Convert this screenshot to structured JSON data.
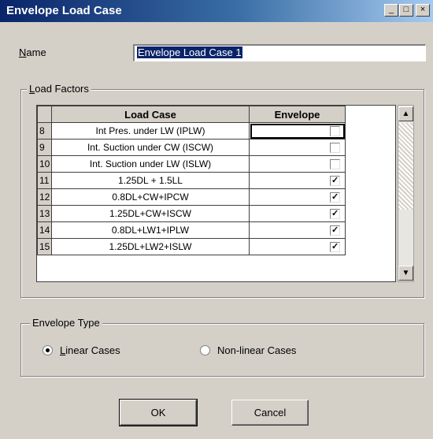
{
  "window": {
    "title": "Envelope Load Case",
    "min_glyph": "_",
    "max_glyph": "□",
    "close_glyph": "×"
  },
  "name_field": {
    "label_u": "N",
    "label_rest": "ame",
    "value": "Envelope Load Case 1"
  },
  "load_factors": {
    "title_u": "L",
    "title_rest": "oad Factors",
    "columns": [
      "Load Case",
      "Envelope"
    ],
    "rows": [
      {
        "id": "8",
        "case": "Int Pres. under LW (IPLW)",
        "envelope": false
      },
      {
        "id": "9",
        "case": "Int. Suction under CW (ISCW)",
        "envelope": false
      },
      {
        "id": "10",
        "case": "Int. Suction under LW (ISLW)",
        "envelope": false
      },
      {
        "id": "11",
        "case": "1.25DL + 1.5LL",
        "envelope": true
      },
      {
        "id": "12",
        "case": "0.8DL+CW+IPCW",
        "envelope": true
      },
      {
        "id": "13",
        "case": "1.25DL+CW+ISCW",
        "envelope": true
      },
      {
        "id": "14",
        "case": "0.8DL+LW1+IPLW",
        "envelope": true
      },
      {
        "id": "15",
        "case": "1.25DL+LW2+ISLW",
        "envelope": true
      }
    ],
    "scroll_up_glyph": "▲",
    "scroll_down_glyph": "▼"
  },
  "envelope_type": {
    "title": "Envelope Type",
    "linear_u": "L",
    "linear_rest": "inear Cases",
    "nonlinear": "Non-linear Cases",
    "selected": "linear"
  },
  "buttons": {
    "ok": "OK",
    "cancel": "Cancel"
  }
}
